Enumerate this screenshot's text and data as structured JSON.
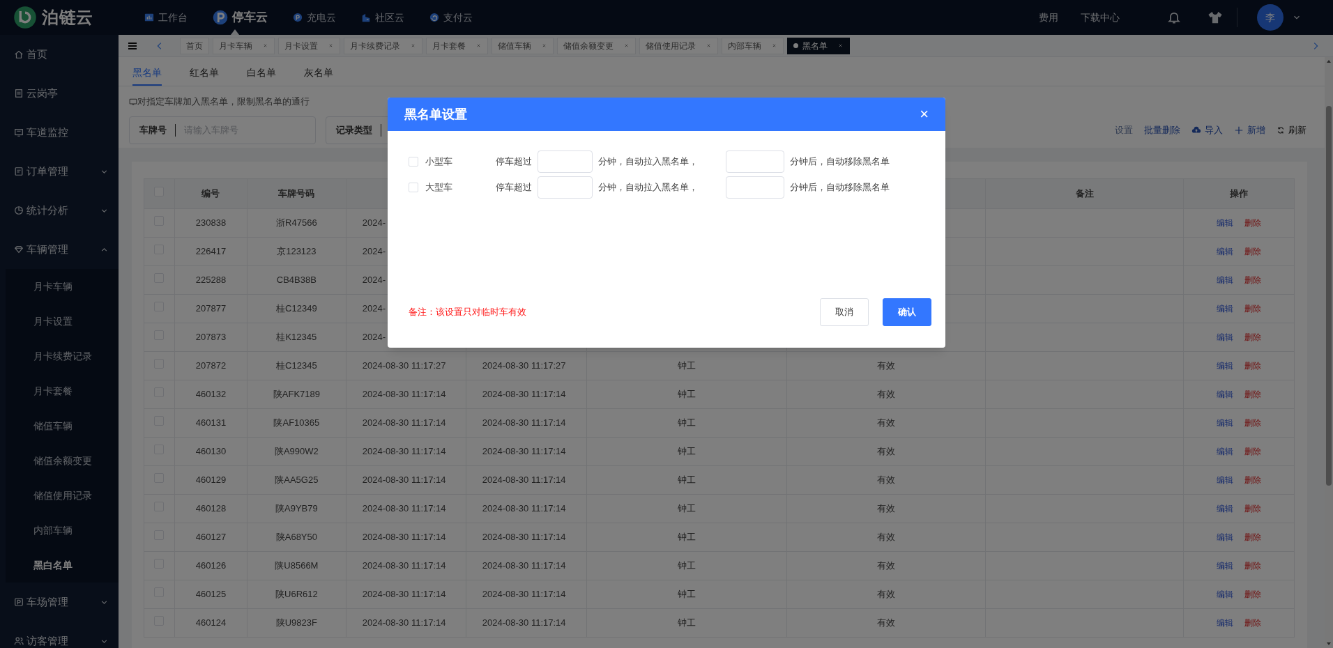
{
  "top_bar": {
    "logo": "泊链云",
    "nav": [
      {
        "label": "工作台",
        "selected": false
      },
      {
        "label": "停车云",
        "selected": true
      },
      {
        "label": "充电云",
        "selected": false
      },
      {
        "label": "社区云",
        "selected": false
      },
      {
        "label": "支付云",
        "selected": false
      }
    ],
    "links": [
      "费用",
      "下载中心"
    ],
    "avatar": "李"
  },
  "sidebar": {
    "items": [
      {
        "label": "首页"
      },
      {
        "label": "云岗亭"
      },
      {
        "label": "车道监控"
      },
      {
        "label": "订单管理",
        "expanded": false
      },
      {
        "label": "统计分析",
        "expanded": false
      },
      {
        "label": "车辆管理",
        "expanded": true,
        "children": [
          {
            "label": "月卡车辆",
            "selected": false
          },
          {
            "label": "月卡设置",
            "selected": false
          },
          {
            "label": "月卡续费记录",
            "selected": false
          },
          {
            "label": "月卡套餐",
            "selected": false
          },
          {
            "label": "储值车辆",
            "selected": false
          },
          {
            "label": "储值余额变更",
            "selected": false
          },
          {
            "label": "储值使用记录",
            "selected": false
          },
          {
            "label": "内部车辆",
            "selected": false
          },
          {
            "label": "黑白名单",
            "selected": true
          }
        ]
      },
      {
        "label": "车场管理",
        "expanded": false
      },
      {
        "label": "访客管理",
        "expanded": false
      }
    ]
  },
  "tabs": [
    {
      "label": "首页",
      "selected": false
    },
    {
      "label": "月卡车辆",
      "selected": false
    },
    {
      "label": "月卡设置",
      "selected": false
    },
    {
      "label": "月卡续费记录",
      "selected": false
    },
    {
      "label": "月卡套餐",
      "selected": false
    },
    {
      "label": "储值车辆",
      "selected": false
    },
    {
      "label": "储值余额变更",
      "selected": false
    },
    {
      "label": "储值使用记录",
      "selected": false
    },
    {
      "label": "内部车辆",
      "selected": false
    },
    {
      "label": "黑名单",
      "selected": true
    }
  ],
  "list_tabs": [
    {
      "label": "黑名单",
      "selected": true
    },
    {
      "label": "红名单",
      "selected": false
    },
    {
      "label": "白名单",
      "selected": false
    },
    {
      "label": "灰名单",
      "selected": false
    }
  ],
  "hint": "对指定车牌加入黑名单，限制黑名单的通行",
  "filters": [
    {
      "label": "车牌号",
      "placeholder": "请输入车牌号"
    },
    {
      "label": "记录类型"
    }
  ],
  "toolbar": [
    {
      "label": "设置",
      "kind": "settings"
    },
    {
      "label": "批量删除",
      "kind": "batch-delete"
    },
    {
      "label": "导入",
      "kind": "import"
    },
    {
      "label": "新增",
      "kind": "add"
    },
    {
      "label": "刷新",
      "kind": "refresh"
    }
  ],
  "table": {
    "select_all_checked": false,
    "columns": [
      "编号",
      "车牌号码",
      null,
      null,
      null,
      null,
      "备注",
      "操作"
    ],
    "rows": [
      {
        "checked": false,
        "cells": [
          "230838",
          "浙R47566",
          "2024-",
          null,
          null,
          null,
          null
        ],
        "actions": [
          "编辑",
          "删除"
        ]
      },
      {
        "checked": false,
        "cells": [
          "226417",
          "京123123",
          "2024-",
          null,
          null,
          null,
          null
        ],
        "actions": [
          "编辑",
          "删除"
        ]
      },
      {
        "checked": false,
        "cells": [
          "225288",
          "CB4B38B",
          "2024-",
          null,
          null,
          null,
          null
        ],
        "actions": [
          "编辑",
          "删除"
        ]
      },
      {
        "checked": false,
        "cells": [
          "207877",
          "桂C12349",
          "2024-",
          null,
          null,
          null,
          null
        ],
        "actions": [
          "编辑",
          "删除"
        ]
      },
      {
        "checked": false,
        "cells": [
          "207873",
          "桂K12345",
          "2024-",
          null,
          null,
          null,
          null
        ],
        "actions": [
          "编辑",
          "删除"
        ]
      },
      {
        "checked": false,
        "cells": [
          "207872",
          "桂C12345",
          "2024-08-30 11:17:27",
          "2024-08-30 11:17:27",
          "钟工",
          "有效",
          null
        ],
        "actions": [
          "编辑",
          "删除"
        ]
      },
      {
        "checked": false,
        "cells": [
          "460132",
          "陕AFK7189",
          "2024-08-30 11:17:14",
          "2024-08-30 11:17:14",
          "钟工",
          "有效",
          null
        ],
        "actions": [
          "编辑",
          "删除"
        ]
      },
      {
        "checked": false,
        "cells": [
          "460131",
          "陕AF10365",
          "2024-08-30 11:17:14",
          "2024-08-30 11:17:14",
          "钟工",
          "有效",
          null
        ],
        "actions": [
          "编辑",
          "删除"
        ]
      },
      {
        "checked": false,
        "cells": [
          "460130",
          "陕A990W2",
          "2024-08-30 11:17:14",
          "2024-08-30 11:17:14",
          "钟工",
          "有效",
          null
        ],
        "actions": [
          "编辑",
          "删除"
        ]
      },
      {
        "checked": false,
        "cells": [
          "460129",
          "陕AA5G25",
          "2024-08-30 11:17:14",
          "2024-08-30 11:17:14",
          "钟工",
          "有效",
          null
        ],
        "actions": [
          "编辑",
          "删除"
        ]
      },
      {
        "checked": false,
        "cells": [
          "460128",
          "陕A9YB79",
          "2024-08-30 11:17:14",
          "2024-08-30 11:17:14",
          "钟工",
          "有效",
          null
        ],
        "actions": [
          "编辑",
          "删除"
        ]
      },
      {
        "checked": false,
        "cells": [
          "460127",
          "陕A68Y50",
          "2024-08-30 11:17:14",
          "2024-08-30 11:17:14",
          "钟工",
          "有效",
          null
        ],
        "actions": [
          "编辑",
          "删除"
        ]
      },
      {
        "checked": false,
        "cells": [
          "460126",
          "陕U8566M",
          "2024-08-30 11:17:14",
          "2024-08-30 11:17:14",
          "钟工",
          "有效",
          null
        ],
        "actions": [
          "编辑",
          "删除"
        ]
      },
      {
        "checked": false,
        "cells": [
          "460125",
          "陕U6R612",
          "2024-08-30 11:17:14",
          "2024-08-30 11:17:14",
          "钟工",
          "有效",
          null
        ],
        "actions": [
          "编辑",
          "删除"
        ]
      },
      {
        "checked": false,
        "cells": [
          "460124",
          "陕U9823F",
          "2024-08-30 11:17:14",
          "2024-08-30 11:17:14",
          "钟工",
          "有效",
          null
        ],
        "actions": [
          "编辑",
          "删除"
        ]
      }
    ]
  },
  "dialog": {
    "title": "黑名单设置",
    "close": "×",
    "rows": [
      {
        "checked": false,
        "label": "小型车",
        "prefix": "停车超过",
        "middle": "分钟，自动拉入黑名单，",
        "suffix": "分钟后，自动移除黑名单"
      },
      {
        "checked": false,
        "label": "大型车",
        "prefix": "停车超过",
        "middle": "分钟，自动拉入黑名单，",
        "suffix": "分钟后，自动移除黑名单"
      }
    ],
    "note": "备注：该设置只对临时车有效",
    "buttons": [
      {
        "label": "取消",
        "kind": "secondary"
      },
      {
        "label": "确认",
        "kind": "primary"
      }
    ]
  }
}
